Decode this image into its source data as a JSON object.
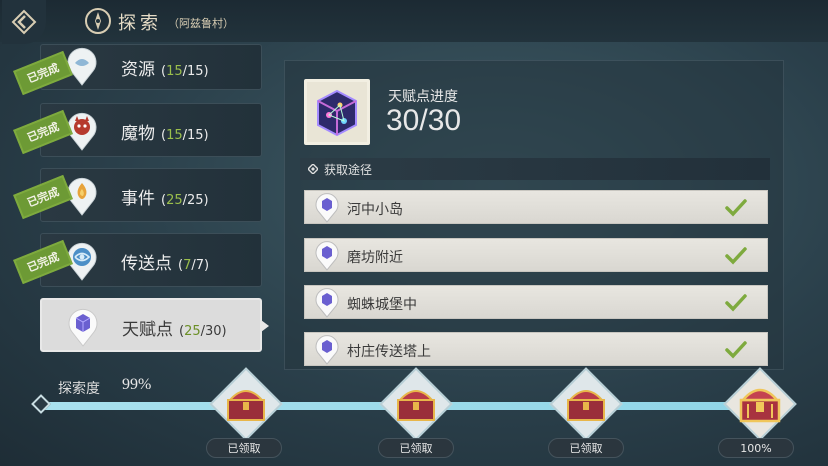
{
  "header": {
    "title": "探索",
    "subtitle": "（阿兹鲁村）"
  },
  "categories": [
    {
      "label": "资源",
      "done": "15",
      "total": "/15",
      "completed": true,
      "stamp": "已完成",
      "icon": "resource-icon"
    },
    {
      "label": "魔物",
      "done": "15",
      "total": "/15",
      "completed": true,
      "stamp": "已完成",
      "icon": "monster-icon"
    },
    {
      "label": "事件",
      "done": "25",
      "total": "/25",
      "completed": true,
      "stamp": "已完成",
      "icon": "event-icon"
    },
    {
      "label": "传送点",
      "done": "7",
      "total": "/7",
      "completed": true,
      "stamp": "已完成",
      "icon": "teleport-icon"
    },
    {
      "label": "天赋点",
      "done": "25",
      "total": "/30",
      "completed": false,
      "icon": "talent-icon",
      "selected": true
    }
  ],
  "talent": {
    "title": "天赋点进度",
    "value": "30/30"
  },
  "sources": {
    "header": "获取途径",
    "items": [
      {
        "name": "河中小岛",
        "completed": true
      },
      {
        "name": "磨坊附近",
        "completed": true
      },
      {
        "name": "蜘蛛城堡中",
        "completed": true
      },
      {
        "name": "村庄传送塔上",
        "completed": true
      }
    ]
  },
  "progress": {
    "label": "探索度",
    "percent_text": "99%",
    "value_percent": 99,
    "rewards": [
      {
        "tag": "已领取"
      },
      {
        "tag": "已领取"
      },
      {
        "tag": "已领取"
      },
      {
        "tag": "100%"
      }
    ]
  },
  "colors": {
    "accent_green": "#7eaa3e",
    "progress": "#8fd4e6"
  }
}
